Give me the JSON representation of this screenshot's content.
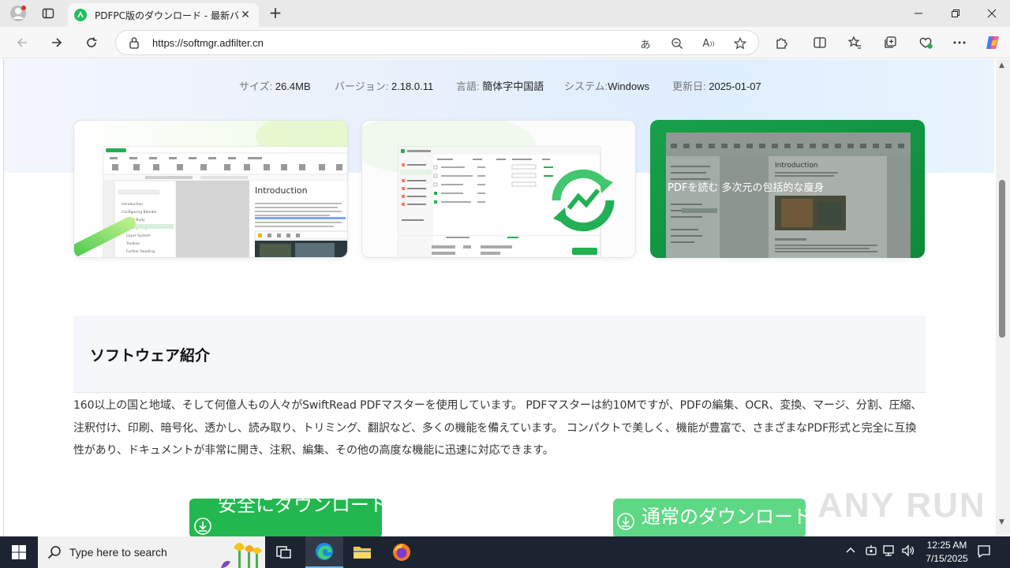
{
  "browser": {
    "tab_title": "PDFPC版のダウンロード - 最新バージョ",
    "url": "https://softmgr.adfilter.cn"
  },
  "meta": {
    "size_label": "サイズ: ",
    "size_value": "26.4MB",
    "version_label": "バージョン: ",
    "version_value": "2.18.0.11",
    "language_label": "言語: ",
    "language_value": "簡体字中国語",
    "system_label": "システム:",
    "system_value": "Windows",
    "updated_label": "更新日: ",
    "updated_value": "2025-01-07"
  },
  "screenshots": {
    "shot1_heading": "Introduction",
    "shot3_heading": "Introduction",
    "shot3_caption": "PDFを読む 多次元の包括的な廋身"
  },
  "intro": {
    "title": "ソフトウェア紹介",
    "text": "160以上の国と地域、そして何億人もの人々がSwiftRead PDFマスターを使用しています。 PDFマスターは約10Mですが、PDFの編集、OCR、変換、マージ、分割、圧縮、注釈付け、印刷、暗号化、透かし、読み取り、トリミング、翻訳など、多くの機能を備えています。 コンパクトで美しく、機能が豊富で、さまざまなPDF形式と完全に互換性があり、ドキュメントが非常に開き、注釈、編集、その他の高度な機能に迅速に対応できます。"
  },
  "downloads": {
    "safe_label": "安全にダウンロード",
    "normal_label": "通常のダウンロード"
  },
  "watermark": "ANY RUN",
  "taskbar": {
    "search_placeholder": "Type here to search",
    "time": "12:25 AM",
    "date": "7/15/2025"
  },
  "colors": {
    "brand_green": "#22b84f",
    "light_green": "#5fd886",
    "taskbar": "#1c2331"
  }
}
